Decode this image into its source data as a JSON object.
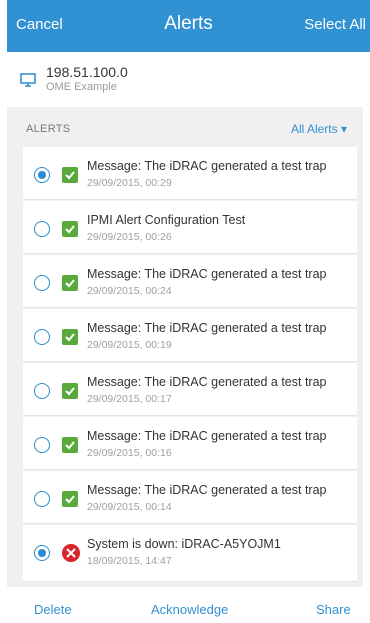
{
  "header": {
    "cancel_label": "Cancel",
    "title": "Alerts",
    "select_all_label": "Select All"
  },
  "device": {
    "icon": "monitor-icon",
    "address": "198.51.100.0",
    "name": "OME Example"
  },
  "panel": {
    "section_label": "ALERTS",
    "filter_label": "All Alerts ▾"
  },
  "alerts": [
    {
      "selected": true,
      "status": "ok",
      "message": "Message: The iDRAC generated a test trap",
      "time": "29/09/2015, 00:29"
    },
    {
      "selected": false,
      "status": "ok",
      "message": "IPMI Alert Configuration Test",
      "time": "29/09/2015, 00:26"
    },
    {
      "selected": false,
      "status": "ok",
      "message": "Message: The iDRAC generated a test trap",
      "time": "29/09/2015, 00:24"
    },
    {
      "selected": false,
      "status": "ok",
      "message": "Message: The iDRAC generated a test trap",
      "time": "29/09/2015, 00:19"
    },
    {
      "selected": false,
      "status": "ok",
      "message": "Message: The iDRAC generated a test trap",
      "time": "29/09/2015, 00:17"
    },
    {
      "selected": false,
      "status": "ok",
      "message": "Message: The iDRAC generated a test trap",
      "time": "29/09/2015, 00:16"
    },
    {
      "selected": false,
      "status": "ok",
      "message": "Message: The iDRAC generated a test trap",
      "time": "29/09/2015, 00:14"
    },
    {
      "selected": true,
      "status": "error",
      "message": "System is down: iDRAC-A5YOJM1",
      "time": "18/09/2015, 14:47"
    }
  ],
  "footer": {
    "delete_label": "Delete",
    "acknowledge_label": "Acknowledge",
    "share_label": "Share"
  },
  "colors": {
    "header_bg": "#3192d3",
    "accent": "#2b8ad0",
    "ok": "#5aa93d",
    "error": "#d6262b"
  }
}
